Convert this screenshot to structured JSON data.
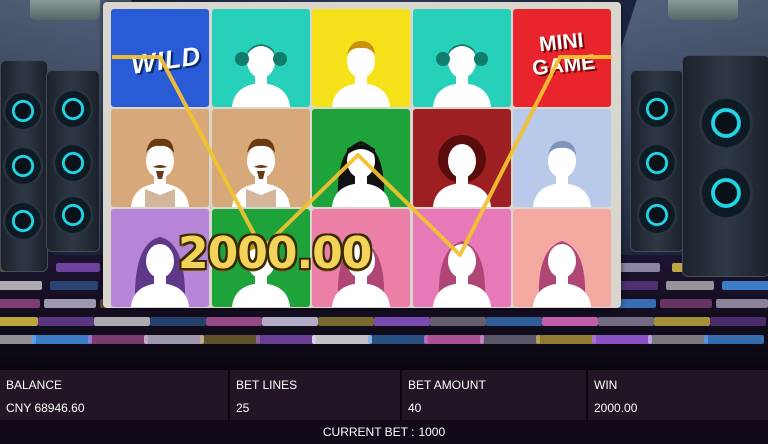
{
  "reels": {
    "symbols": [
      [
        "wild",
        "girl-pigtails",
        "boy",
        "girl-pigtails",
        "mini-game"
      ],
      [
        "man-mustache",
        "man-mustache",
        "woman-bob",
        "woman-afro",
        "man-short"
      ],
      [
        "man-hood",
        "boy",
        "woman-long",
        "woman-long",
        "woman-long"
      ]
    ],
    "wild_label": "WILD",
    "mini_game_line1": "MINI",
    "mini_game_line2": "GAME"
  },
  "win_display": "2000.00",
  "info": {
    "balance_label": "BALANCE",
    "balance_value": "CNY 68946.60",
    "bet_lines_label": "BET LINES",
    "bet_lines_value": "25",
    "bet_amount_label": "BET AMOUNT",
    "bet_amount_value": "40",
    "win_label": "WIN",
    "win_value": "2000.00"
  },
  "current_bet": {
    "label": "CURRENT BET :",
    "value": "1000"
  },
  "colors": {
    "payline": "#f2c230",
    "win_text": "#f4d35a",
    "info_bar": "#221626"
  }
}
